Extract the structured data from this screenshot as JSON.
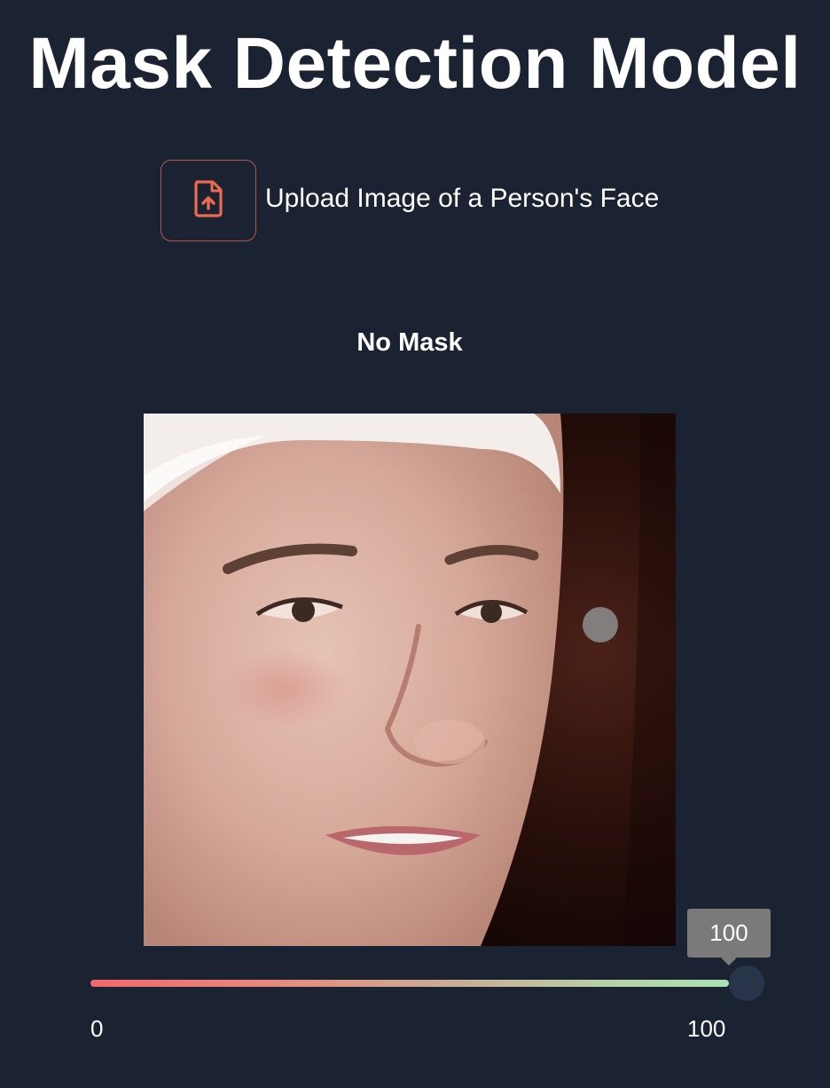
{
  "page": {
    "title": "Mask Detection Model"
  },
  "upload": {
    "label": "Upload Image of a Person's Face",
    "icon": "file-upload-icon",
    "accent_color": "#ec6a4f"
  },
  "result": {
    "label": "No Mask"
  },
  "slider": {
    "value": 100,
    "value_label": "100",
    "min": 0,
    "max": 100,
    "min_label": "0",
    "max_label": "100"
  },
  "colors": {
    "background": "#1b2333",
    "slider_start": "#f2676e",
    "slider_end": "#a9e3b3",
    "thumb": "#28344a",
    "tooltip": "#7a7a7a"
  }
}
